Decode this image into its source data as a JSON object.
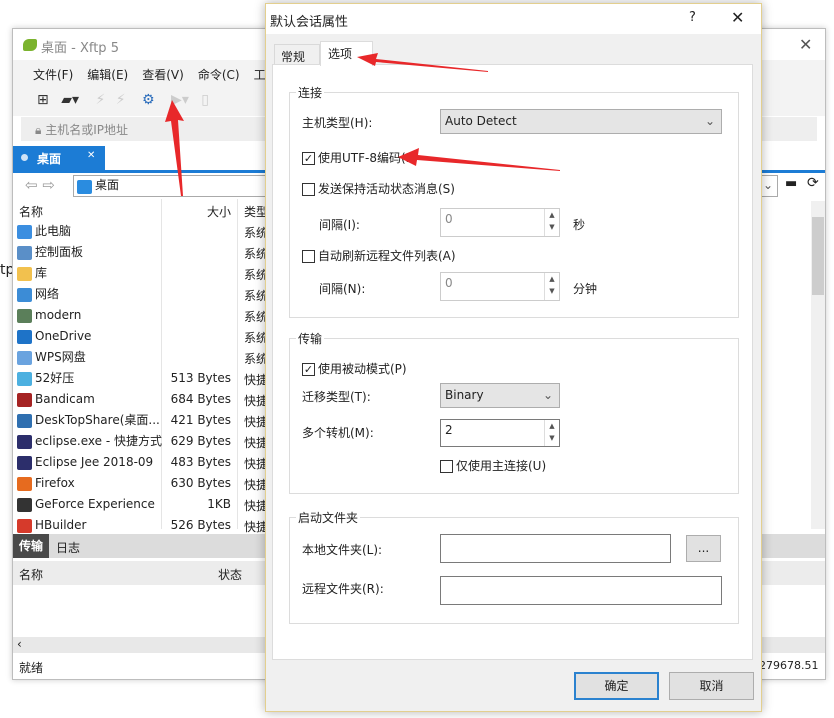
{
  "background_fragment": "tp",
  "main": {
    "title": "桌面 - Xftp 5",
    "menu": [
      "文件(F)",
      "编辑(E)",
      "查看(V)",
      "命令(C)",
      "工"
    ],
    "address_placeholder": "主机名或IP地址",
    "tab": "桌面",
    "path": "桌面",
    "columns": {
      "name": "名称",
      "size": "大小",
      "type": "类型"
    },
    "files": [
      {
        "name": "此电脑",
        "size": "",
        "type": "系统",
        "color": "#3b8ee0"
      },
      {
        "name": "控制面板",
        "size": "",
        "type": "系统",
        "color": "#5a8fc8"
      },
      {
        "name": "库",
        "size": "",
        "type": "系统",
        "color": "#f2c14e"
      },
      {
        "name": "网络",
        "size": "",
        "type": "系统",
        "color": "#3c8cd6"
      },
      {
        "name": "modern",
        "size": "",
        "type": "系统",
        "color": "#5b7f5a"
      },
      {
        "name": "OneDrive",
        "size": "",
        "type": "系统",
        "color": "#1e73c8"
      },
      {
        "name": "WPS网盘",
        "size": "",
        "type": "系统",
        "color": "#6aa3df"
      },
      {
        "name": "52好压",
        "size": "513 Bytes",
        "type": "快捷",
        "color": "#4cb0e0"
      },
      {
        "name": "Bandicam",
        "size": "684 Bytes",
        "type": "快捷",
        "color": "#a52323"
      },
      {
        "name": "DeskTopShare(桌面...",
        "size": "421 Bytes",
        "type": "快捷",
        "color": "#2f6fb0"
      },
      {
        "name": "eclipse.exe - 快捷方式",
        "size": "629 Bytes",
        "type": "快捷",
        "color": "#2c2e6b"
      },
      {
        "name": "Eclipse Jee 2018-09",
        "size": "483 Bytes",
        "type": "快捷",
        "color": "#2c2e6b"
      },
      {
        "name": "Firefox",
        "size": "630 Bytes",
        "type": "快捷",
        "color": "#e66b1f"
      },
      {
        "name": "GeForce Experience",
        "size": "1KB",
        "type": "快捷",
        "color": "#333333"
      },
      {
        "name": "HBuilder",
        "size": "526 Bytes",
        "type": "快捷",
        "color": "#d63a2b"
      }
    ],
    "bottom_tabs": [
      "传输",
      "日志"
    ],
    "transfer_columns": {
      "name": "名称",
      "status": "状态"
    },
    "status": "就绪",
    "status_right": "279678.51"
  },
  "dialog": {
    "title": "默认会话属性",
    "help": "?",
    "tabs": [
      "常规",
      "选项"
    ],
    "connection": {
      "legend": "连接",
      "host_type_label": "主机类型(H):",
      "host_type": "Auto Detect",
      "utf8_label": "使用UTF-8编码(E)",
      "utf8": true,
      "keepalive_label": "发送保持活动状态消息(S)",
      "keepalive": false,
      "interval_label": "间隔(I):",
      "interval": "0",
      "interval_unit": "秒",
      "autorefresh_label": "自动刷新远程文件列表(A)",
      "autorefresh": false,
      "refresh_label": "间隔(N):",
      "refresh": "0",
      "refresh_unit": "分钟"
    },
    "transfer": {
      "legend": "传输",
      "passive_label": "使用被动模式(P)",
      "passive": true,
      "type_label": "迁移类型(T):",
      "type": "Binary",
      "multi_label": "多个转机(M):",
      "multi": "2",
      "main_only_label": "仅使用主连接(U)",
      "main_only": false
    },
    "startup": {
      "legend": "启动文件夹",
      "local_label": "本地文件夹(L):",
      "local": "",
      "browse": "...",
      "remote_label": "远程文件夹(R):",
      "remote": ""
    },
    "ok": "确定",
    "cancel": "取消"
  },
  "annotation_color": "#e8282a"
}
